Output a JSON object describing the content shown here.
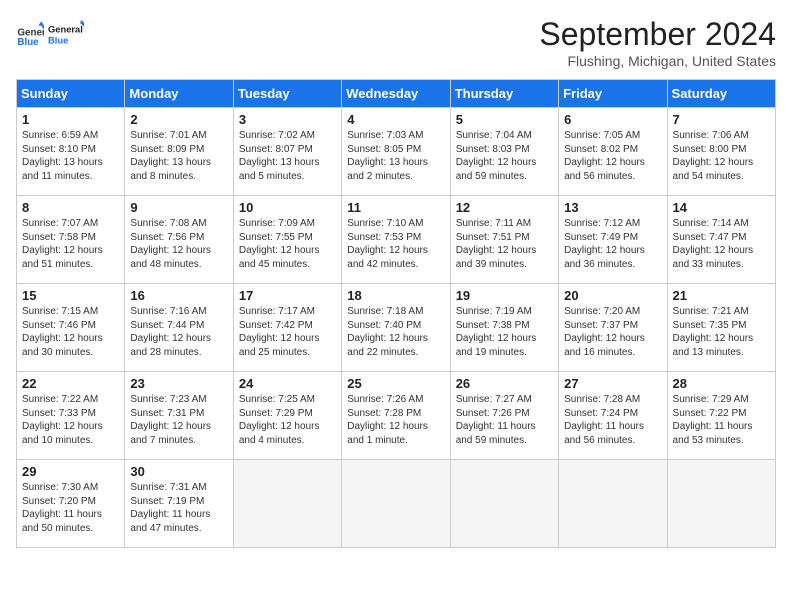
{
  "header": {
    "logo_line1": "General",
    "logo_line2": "Blue",
    "month": "September 2024",
    "location": "Flushing, Michigan, United States"
  },
  "days_of_week": [
    "Sunday",
    "Monday",
    "Tuesday",
    "Wednesday",
    "Thursday",
    "Friday",
    "Saturday"
  ],
  "weeks": [
    [
      {
        "day": "1",
        "content": "Sunrise: 6:59 AM\nSunset: 8:10 PM\nDaylight: 13 hours and 11 minutes."
      },
      {
        "day": "2",
        "content": "Sunrise: 7:01 AM\nSunset: 8:09 PM\nDaylight: 13 hours and 8 minutes."
      },
      {
        "day": "3",
        "content": "Sunrise: 7:02 AM\nSunset: 8:07 PM\nDaylight: 13 hours and 5 minutes."
      },
      {
        "day": "4",
        "content": "Sunrise: 7:03 AM\nSunset: 8:05 PM\nDaylight: 13 hours and 2 minutes."
      },
      {
        "day": "5",
        "content": "Sunrise: 7:04 AM\nSunset: 8:03 PM\nDaylight: 12 hours and 59 minutes."
      },
      {
        "day": "6",
        "content": "Sunrise: 7:05 AM\nSunset: 8:02 PM\nDaylight: 12 hours and 56 minutes."
      },
      {
        "day": "7",
        "content": "Sunrise: 7:06 AM\nSunset: 8:00 PM\nDaylight: 12 hours and 54 minutes."
      }
    ],
    [
      {
        "day": "8",
        "content": "Sunrise: 7:07 AM\nSunset: 7:58 PM\nDaylight: 12 hours and 51 minutes."
      },
      {
        "day": "9",
        "content": "Sunrise: 7:08 AM\nSunset: 7:56 PM\nDaylight: 12 hours and 48 minutes."
      },
      {
        "day": "10",
        "content": "Sunrise: 7:09 AM\nSunset: 7:55 PM\nDaylight: 12 hours and 45 minutes."
      },
      {
        "day": "11",
        "content": "Sunrise: 7:10 AM\nSunset: 7:53 PM\nDaylight: 12 hours and 42 minutes."
      },
      {
        "day": "12",
        "content": "Sunrise: 7:11 AM\nSunset: 7:51 PM\nDaylight: 12 hours and 39 minutes."
      },
      {
        "day": "13",
        "content": "Sunrise: 7:12 AM\nSunset: 7:49 PM\nDaylight: 12 hours and 36 minutes."
      },
      {
        "day": "14",
        "content": "Sunrise: 7:14 AM\nSunset: 7:47 PM\nDaylight: 12 hours and 33 minutes."
      }
    ],
    [
      {
        "day": "15",
        "content": "Sunrise: 7:15 AM\nSunset: 7:46 PM\nDaylight: 12 hours and 30 minutes."
      },
      {
        "day": "16",
        "content": "Sunrise: 7:16 AM\nSunset: 7:44 PM\nDaylight: 12 hours and 28 minutes."
      },
      {
        "day": "17",
        "content": "Sunrise: 7:17 AM\nSunset: 7:42 PM\nDaylight: 12 hours and 25 minutes."
      },
      {
        "day": "18",
        "content": "Sunrise: 7:18 AM\nSunset: 7:40 PM\nDaylight: 12 hours and 22 minutes."
      },
      {
        "day": "19",
        "content": "Sunrise: 7:19 AM\nSunset: 7:38 PM\nDaylight: 12 hours and 19 minutes."
      },
      {
        "day": "20",
        "content": "Sunrise: 7:20 AM\nSunset: 7:37 PM\nDaylight: 12 hours and 16 minutes."
      },
      {
        "day": "21",
        "content": "Sunrise: 7:21 AM\nSunset: 7:35 PM\nDaylight: 12 hours and 13 minutes."
      }
    ],
    [
      {
        "day": "22",
        "content": "Sunrise: 7:22 AM\nSunset: 7:33 PM\nDaylight: 12 hours and 10 minutes."
      },
      {
        "day": "23",
        "content": "Sunrise: 7:23 AM\nSunset: 7:31 PM\nDaylight: 12 hours and 7 minutes."
      },
      {
        "day": "24",
        "content": "Sunrise: 7:25 AM\nSunset: 7:29 PM\nDaylight: 12 hours and 4 minutes."
      },
      {
        "day": "25",
        "content": "Sunrise: 7:26 AM\nSunset: 7:28 PM\nDaylight: 12 hours and 1 minute."
      },
      {
        "day": "26",
        "content": "Sunrise: 7:27 AM\nSunset: 7:26 PM\nDaylight: 11 hours and 59 minutes."
      },
      {
        "day": "27",
        "content": "Sunrise: 7:28 AM\nSunset: 7:24 PM\nDaylight: 11 hours and 56 minutes."
      },
      {
        "day": "28",
        "content": "Sunrise: 7:29 AM\nSunset: 7:22 PM\nDaylight: 11 hours and 53 minutes."
      }
    ],
    [
      {
        "day": "29",
        "content": "Sunrise: 7:30 AM\nSunset: 7:20 PM\nDaylight: 11 hours and 50 minutes."
      },
      {
        "day": "30",
        "content": "Sunrise: 7:31 AM\nSunset: 7:19 PM\nDaylight: 11 hours and 47 minutes."
      },
      {
        "day": "",
        "content": ""
      },
      {
        "day": "",
        "content": ""
      },
      {
        "day": "",
        "content": ""
      },
      {
        "day": "",
        "content": ""
      },
      {
        "day": "",
        "content": ""
      }
    ]
  ]
}
